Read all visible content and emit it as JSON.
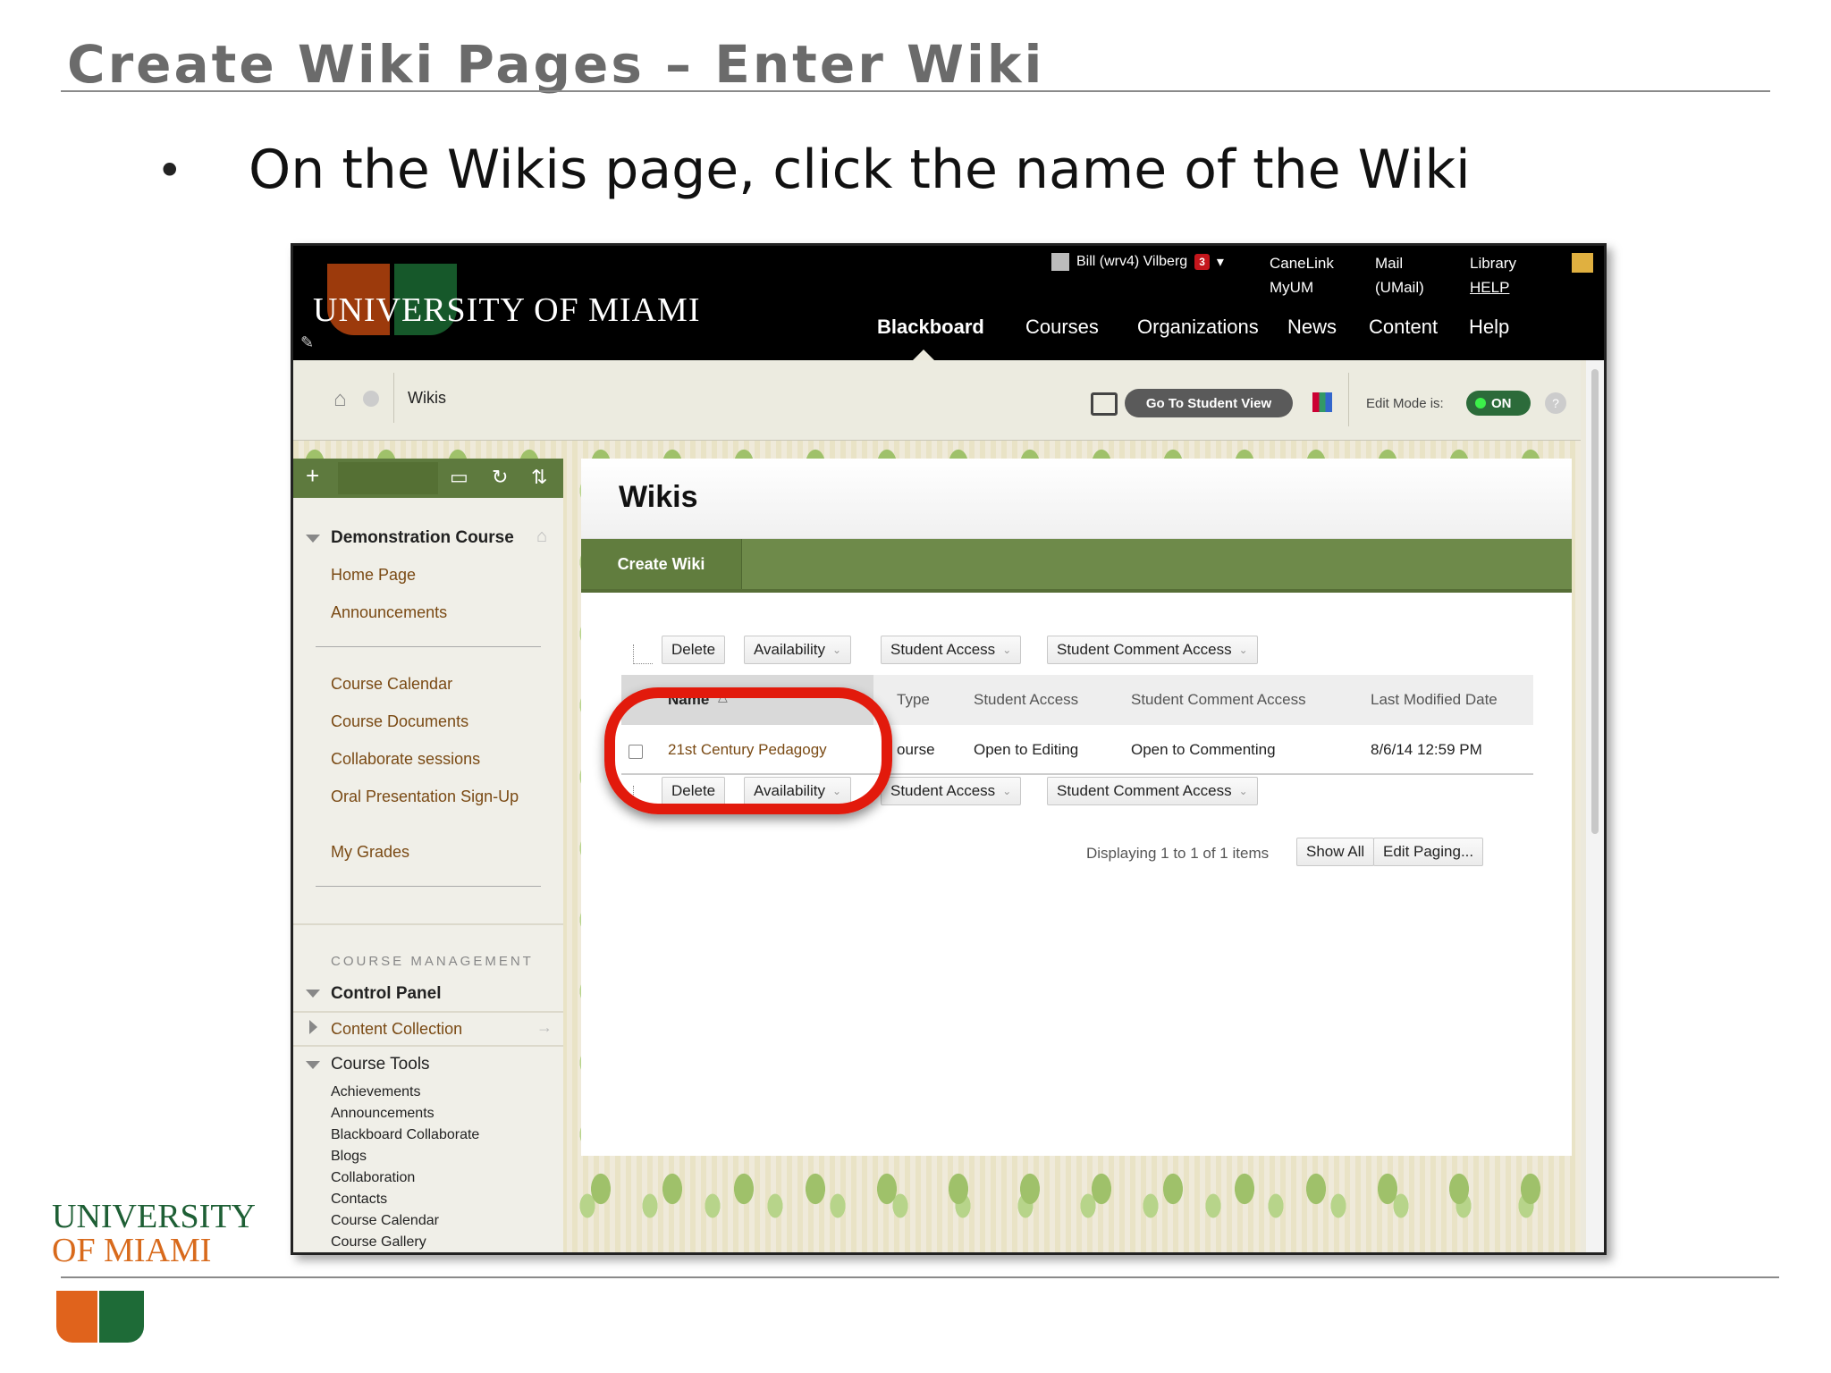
{
  "slide": {
    "title": "Create Wiki Pages – Enter Wiki",
    "bullet_dot": "•",
    "bullet": "On the Wikis page, click the name of the Wiki"
  },
  "topbar": {
    "brand": "UNIVERSITY OF MIAMI",
    "user_name": "Bill (wrv4) Vilberg",
    "notif_count": "3",
    "links": [
      {
        "l1": "CaneLink",
        "l2": "MyUM"
      },
      {
        "l1": "Mail",
        "l2": "(UMail)"
      },
      {
        "l1": "Library",
        "l2": "HELP"
      }
    ],
    "nav": [
      "Blackboard",
      "Courses",
      "Organizations",
      "News",
      "Content",
      "Help"
    ]
  },
  "breadcrumb": {
    "current": "Wikis",
    "student_view": "Go To Student View",
    "edit_mode_label": "Edit Mode is:",
    "edit_mode_value": "ON",
    "help": "?"
  },
  "sidebar": {
    "course_name": "Demonstration Course",
    "items_a": [
      "Home Page",
      "Announcements"
    ],
    "items_b": [
      "Course Calendar",
      "Course Documents",
      "Collaborate sessions",
      "Oral Presentation Sign-Up",
      "My Grades"
    ],
    "management_label": "COURSE MANAGEMENT",
    "control_panel": "Control Panel",
    "content_collection": "Content Collection",
    "course_tools": "Course Tools",
    "tools": [
      "Achievements",
      "Announcements",
      "Blackboard Collaborate",
      "Blogs",
      "Collaboration",
      "Contacts",
      "Course Calendar",
      "Course Gallery"
    ]
  },
  "content": {
    "title": "Wikis",
    "create_button": "Create Wiki",
    "toolbar": [
      "Delete",
      "Availability",
      "Student Access",
      "Student Comment Access"
    ],
    "columns": [
      "Name",
      "Type",
      "Student Access",
      "Student Comment Access",
      "Last Modified Date"
    ],
    "rows": [
      {
        "name": "21st Century Pedagogy",
        "type": "ourse",
        "student_access": "Open to Editing",
        "comment_access": "Open to Commenting",
        "modified": "8/6/14 12:59 PM"
      }
    ],
    "paging": "Displaying 1 to 1 of 1 items",
    "show_all": "Show All",
    "edit_paging": "Edit Paging..."
  },
  "footer": {
    "logo_line1": "UNIVERSITY",
    "logo_line2": "OF MIAMI"
  },
  "colors": {
    "highlight_ring": "#e21a0c",
    "action_bar": "#6e8a4a",
    "link_brown": "#7a4a14",
    "um_orange": "#e0631c",
    "um_green": "#1e6b37"
  }
}
